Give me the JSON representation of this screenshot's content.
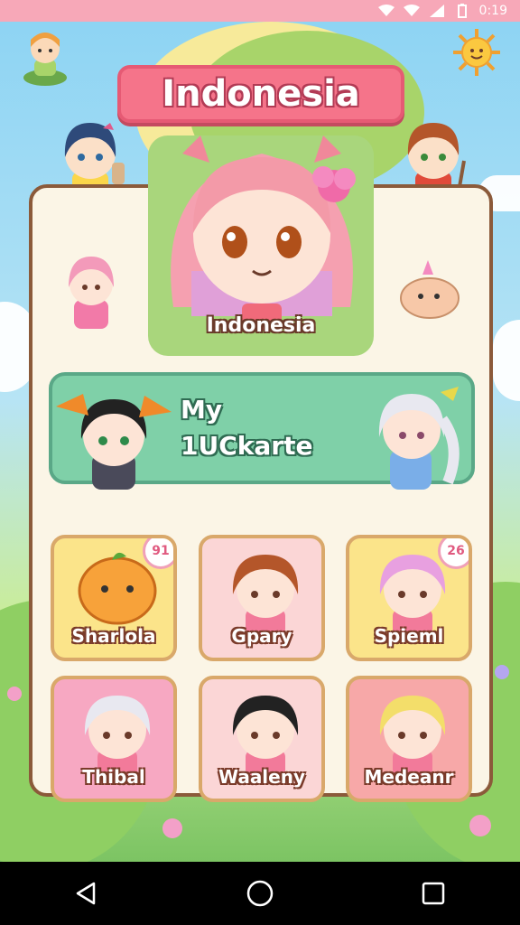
{
  "status_bar": {
    "time": "0:19",
    "icons": [
      "wifi-icon",
      "signal-icon",
      "signal-icon",
      "battery-icon"
    ]
  },
  "header": {
    "title": "Indonesia"
  },
  "hero": {
    "name": "Indonesia"
  },
  "my_bar": {
    "line1": "My",
    "line2": "1UCkarte"
  },
  "cards": [
    {
      "label": "Sharlola",
      "badge": "91",
      "bg": "#fbe48a"
    },
    {
      "label": "Gpary",
      "badge": "",
      "bg": "#fbd6d6"
    },
    {
      "label": "Spieml",
      "badge": "26",
      "bg": "#fbe48a"
    },
    {
      "label": "Thibal",
      "badge": "",
      "bg": "#f7a8c2"
    },
    {
      "label": "Waaleny",
      "badge": "",
      "bg": "#fbd6d6"
    },
    {
      "label": "Medeanr",
      "badge": "",
      "bg": "#f7a8a8"
    }
  ],
  "nav": {
    "back": "back-icon",
    "home": "home-icon",
    "recents": "recents-icon"
  },
  "colors": {
    "accent": "#f5748a",
    "panel_border": "#8b5a3a",
    "my_bar": "#7fd0a8"
  }
}
